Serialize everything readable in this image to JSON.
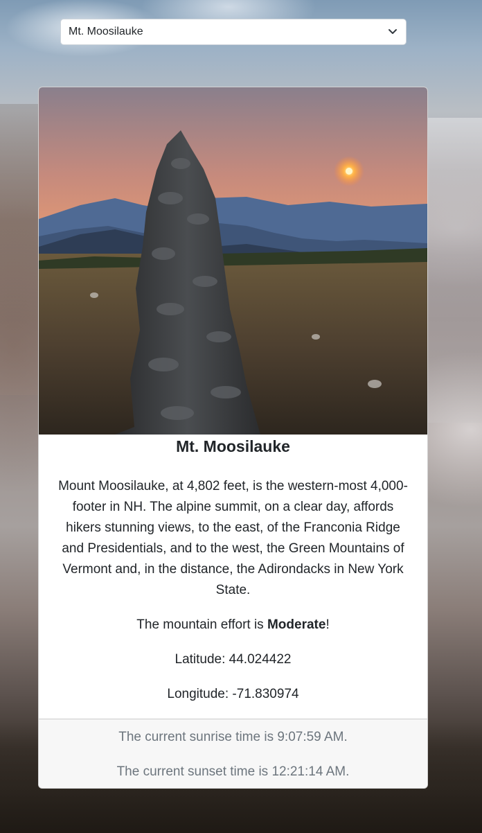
{
  "selector": {
    "selected": "Mt. Moosilauke",
    "icon": "chevron-down-icon"
  },
  "card": {
    "image_alt": "Stone cairn on mountain summit at sunset",
    "title": "Mt. Moosilauke",
    "description": "Mount Moosilauke, at 4,802 feet, is the western-most 4,000-footer in NH. The alpine summit, on a clear day, affords hikers stunning views, to the east, of the Franconia Ridge and Presidentials, and to the west, the Green Mountains of Vermont and, in the distance, the Adirondacks in New York State.",
    "effort_prefix": "The mountain effort is ",
    "effort_value": "Moderate",
    "effort_suffix": "!",
    "latitude_text": "Latitude: 44.024422",
    "longitude_text": "Longitude: -71.830974"
  },
  "footer": {
    "sunrise_text": "The current sunrise time is 9:07:59 AM.",
    "sunset_text": "The current sunset time is 12:21:14 AM."
  },
  "colors": {
    "card_bg": "#ffffff",
    "footer_bg": "#f7f7f7",
    "muted_text": "#6c757d"
  }
}
